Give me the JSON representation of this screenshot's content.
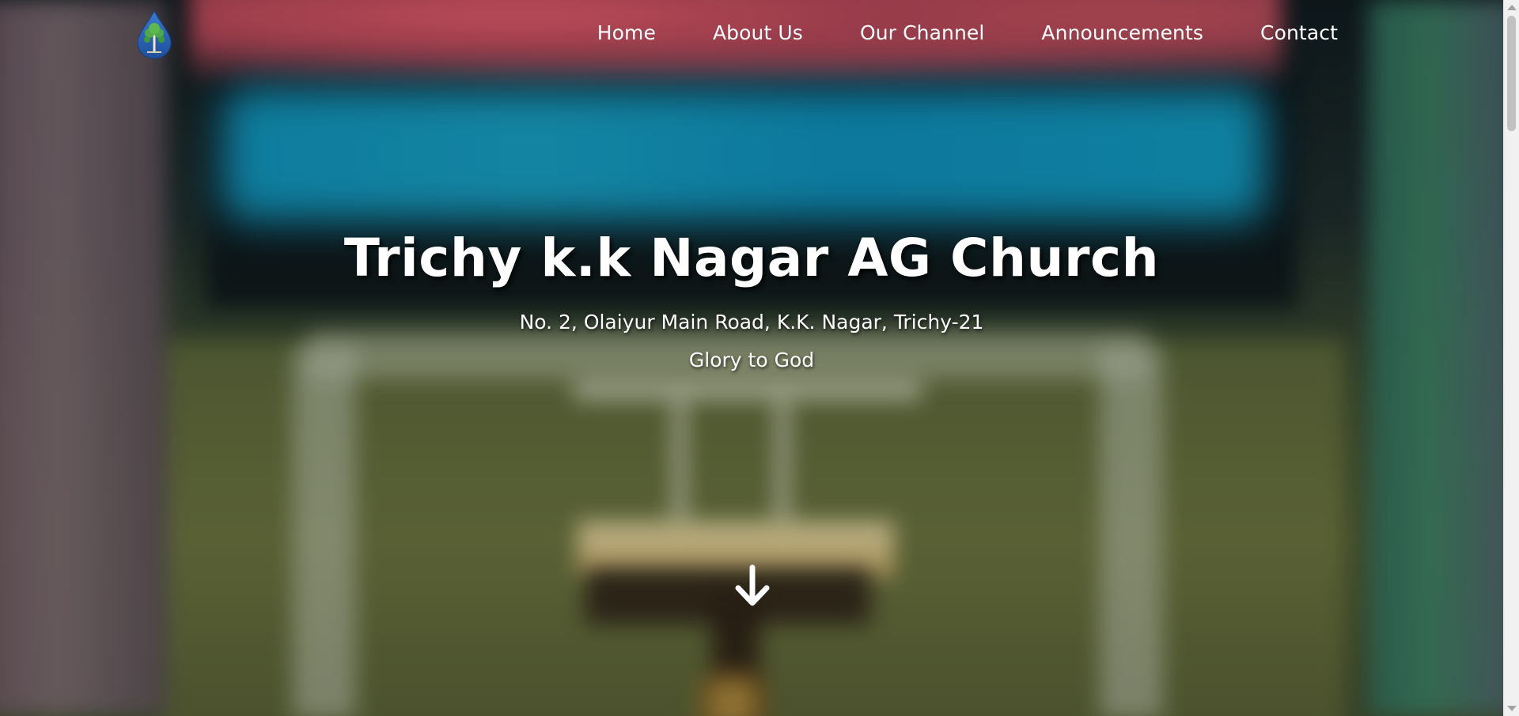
{
  "navbar": {
    "logo_icon": "church-tree-drop-logo",
    "items": [
      {
        "label": "Home"
      },
      {
        "label": "About Us"
      },
      {
        "label": "Our Channel"
      },
      {
        "label": "Announcements"
      },
      {
        "label": "Contact"
      }
    ]
  },
  "hero": {
    "title": "Trichy k.k Nagar AG Church",
    "address": "No. 2, Olaiyur Main Road, K.K. Nagar, Trichy-21",
    "tagline": "Glory to God",
    "scroll_icon": "arrow-down-icon"
  },
  "colors": {
    "text": "#ffffff",
    "logo_blue": "#2a5fb0",
    "logo_green": "#4fa84a",
    "scrollbar_track": "#f1f1f1",
    "scrollbar_thumb": "#c1c1c1"
  }
}
